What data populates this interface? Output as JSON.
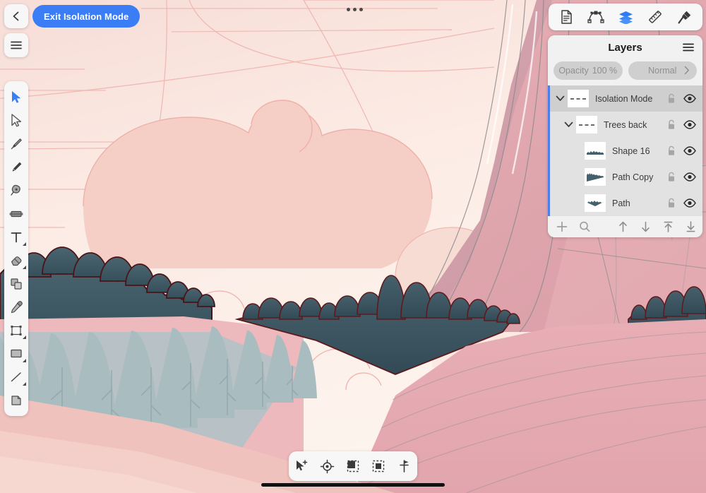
{
  "app": {
    "exit_isolation_label": "Exit Isolation Mode",
    "overflow_menu": "more-options"
  },
  "persona_bar": {
    "buttons": [
      {
        "name": "document-persona",
        "icon": "document-icon"
      },
      {
        "name": "pixel-persona",
        "icon": "node-curve-icon"
      },
      {
        "name": "layers-persona",
        "icon": "layers-icon",
        "active": true
      },
      {
        "name": "stroke-persona",
        "icon": "ruler-icon"
      },
      {
        "name": "fill-persona",
        "icon": "brush-icon"
      }
    ]
  },
  "left_toolbar": {
    "tools": [
      {
        "name": "move-tool",
        "icon": "cursor-filled-icon",
        "active": true,
        "submenu": false
      },
      {
        "name": "node-tool",
        "icon": "cursor-outline-icon",
        "submenu": false
      },
      {
        "name": "pen-tool",
        "icon": "pen-nib-icon",
        "submenu": false
      },
      {
        "name": "pencil-tool",
        "icon": "pencil-icon",
        "submenu": false
      },
      {
        "name": "brush-tool",
        "icon": "paintbrush-icon",
        "submenu": false
      },
      {
        "name": "fill-tool",
        "icon": "fill-cylinder-icon",
        "submenu": false
      },
      {
        "name": "text-tool",
        "icon": "text-t-icon",
        "submenu": true
      },
      {
        "name": "eraser-tool",
        "icon": "eraser-icon",
        "submenu": true
      },
      {
        "name": "shape-builder-tool",
        "icon": "shape-builder-icon",
        "submenu": false
      },
      {
        "name": "color-picker-tool",
        "icon": "eyedropper-icon",
        "submenu": false
      },
      {
        "name": "transform-tool",
        "icon": "transform-frame-icon",
        "submenu": true
      },
      {
        "name": "rectangle-tool",
        "icon": "rectangle-icon",
        "submenu": true
      },
      {
        "name": "line-tool",
        "icon": "line-icon",
        "submenu": true
      },
      {
        "name": "artboard-tool",
        "icon": "artboard-corner-icon",
        "submenu": false
      }
    ]
  },
  "layers_panel": {
    "title": "Layers",
    "menu_icon": "hamburger-icon",
    "opacity_label": "Opacity",
    "opacity_value": "100 %",
    "blend_mode": "Normal",
    "rows": [
      {
        "name": "Isolation Mode",
        "indent": 0,
        "selected": true,
        "expanded": true,
        "has_disclosure": true,
        "thumb": "dashed-line",
        "lock": "lock-icon",
        "visibility": "eye-icon"
      },
      {
        "name": "Trees back",
        "indent": 1,
        "selected": false,
        "expanded": true,
        "has_disclosure": true,
        "thumb": "dashed-line",
        "lock": "lock-icon",
        "visibility": "eye-icon"
      },
      {
        "name": "Shape 16",
        "indent": 2,
        "selected": false,
        "has_disclosure": false,
        "thumb": "forest-flat",
        "lock": "lock-icon",
        "visibility": "eye-icon"
      },
      {
        "name": "Path Copy",
        "indent": 2,
        "selected": false,
        "has_disclosure": false,
        "thumb": "forest-wedge",
        "lock": "lock-icon",
        "visibility": "eye-icon"
      },
      {
        "name": "Path",
        "indent": 2,
        "selected": false,
        "has_disclosure": false,
        "thumb": "forest-v",
        "lock": "lock-icon",
        "visibility": "eye-icon"
      }
    ],
    "footer_buttons": [
      {
        "name": "add-layer-button",
        "icon": "plus-icon"
      },
      {
        "name": "search-layers-button",
        "icon": "search-icon"
      },
      {
        "name": "move-up-button",
        "icon": "arrow-up-icon"
      },
      {
        "name": "move-down-button",
        "icon": "arrow-down-icon"
      },
      {
        "name": "move-to-top-button",
        "icon": "arrow-to-top-icon"
      },
      {
        "name": "move-to-bottom-button",
        "icon": "arrow-to-bottom-icon"
      }
    ]
  },
  "bottom_toolbar": {
    "buttons": [
      {
        "name": "select-add-button",
        "icon": "cursor-plus-icon"
      },
      {
        "name": "align-center-button",
        "icon": "crosshair-target-icon"
      },
      {
        "name": "insert-behind-button",
        "icon": "square-corner-icon"
      },
      {
        "name": "insert-inside-button",
        "icon": "square-nested-icon"
      },
      {
        "name": "snap-button",
        "icon": "pin-flag-icon"
      }
    ]
  },
  "colors": {
    "accent_blue": "#3b7df5",
    "selection_blue": "#4a7ef0",
    "sky_top": "#f8ded8",
    "sky_light": "#fdf1ea",
    "cloud_pink": "#f5cfc6",
    "mountain_pink": "#e3aab0",
    "mountain_dark": "#c9919d",
    "forest_dark": "#3d5560",
    "forest_outline": "#4a1418",
    "tree_blue": "#a9bcc0",
    "hill_pink": "#e7acb3",
    "hill_light": "#f3cdc8",
    "panel_bg": "#f1f1f1",
    "list_bg": "#e2e2e2",
    "row_selected": "#cfcfcf"
  }
}
